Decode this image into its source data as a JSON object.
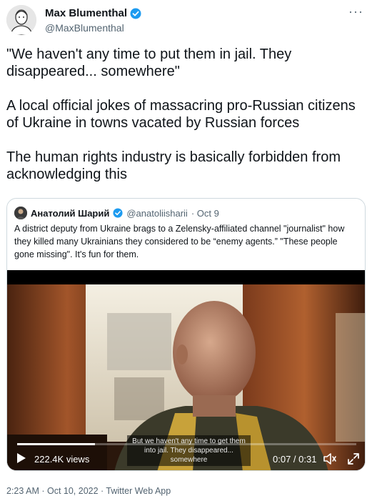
{
  "author": {
    "name": "Max Blumenthal",
    "handle": "@MaxBlumenthal",
    "verified": true
  },
  "tweet_text": "\"We haven't any time to put them in jail. They disappeared... somewhere\"\n\nA local official jokes of massacring pro-Russian citizens of Ukraine in towns vacated by Russian forces\n\nThe human rights industry is basically forbidden from acknowledging this",
  "quoted": {
    "name": "Анатолий Шарий",
    "handle": "@anatoliisharii",
    "date": "· Oct 9",
    "verified": true,
    "text": "A district deputy from Ukraine brags to a Zelensky-affiliated channel  \"journalist\" how they killed many Ukrainians they considered to be “enemy agents.”  \"These people gone missing\". It's fun for them.",
    "video": {
      "caption": "But we haven't any time to get them into jail. They disappeared... somewhere",
      "views": "222.4K views",
      "time": "0:07 / 0:31",
      "progress": 0.23
    }
  },
  "footer": "2:23 AM · Oct 10, 2022 · Twitter Web App",
  "colors": {
    "verified": "#1d9bf0",
    "text": "#0f1419",
    "muted": "#536471",
    "border": "#cfd9de"
  }
}
